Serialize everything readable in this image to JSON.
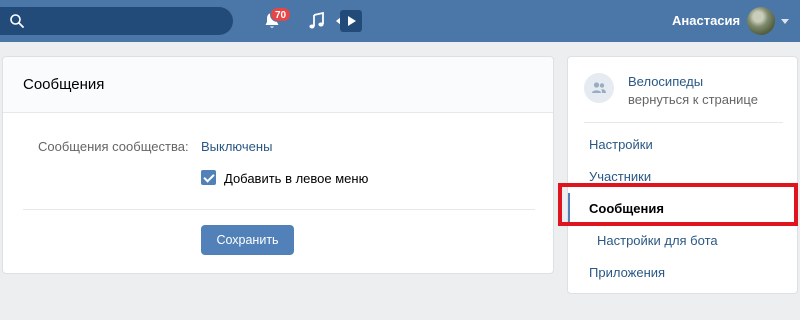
{
  "topbar": {
    "notifications_count": "70",
    "user_name": "Анастасия",
    "icons": [
      "search-icon",
      "bell-icon",
      "music-icon",
      "video-icon"
    ]
  },
  "main": {
    "title": "Сообщения",
    "community_messages_label": "Сообщения сообщества:",
    "community_messages_value": "Выключены",
    "add_to_menu_label": "Добавить в левое меню",
    "add_to_menu_checked": true,
    "save_label": "Сохранить"
  },
  "sidebar": {
    "group_name": "Велосипеды",
    "back_link": "вернуться к странице",
    "items": [
      {
        "label": "Настройки"
      },
      {
        "label": "Участники"
      },
      {
        "label": "Сообщения",
        "active": true
      },
      {
        "label": "Настройки для бота"
      },
      {
        "label": "Приложения"
      }
    ]
  },
  "colors": {
    "header": "#4a76a8",
    "accent": "#5181b8",
    "link": "#2a5885",
    "highlight": "#e0141e"
  }
}
